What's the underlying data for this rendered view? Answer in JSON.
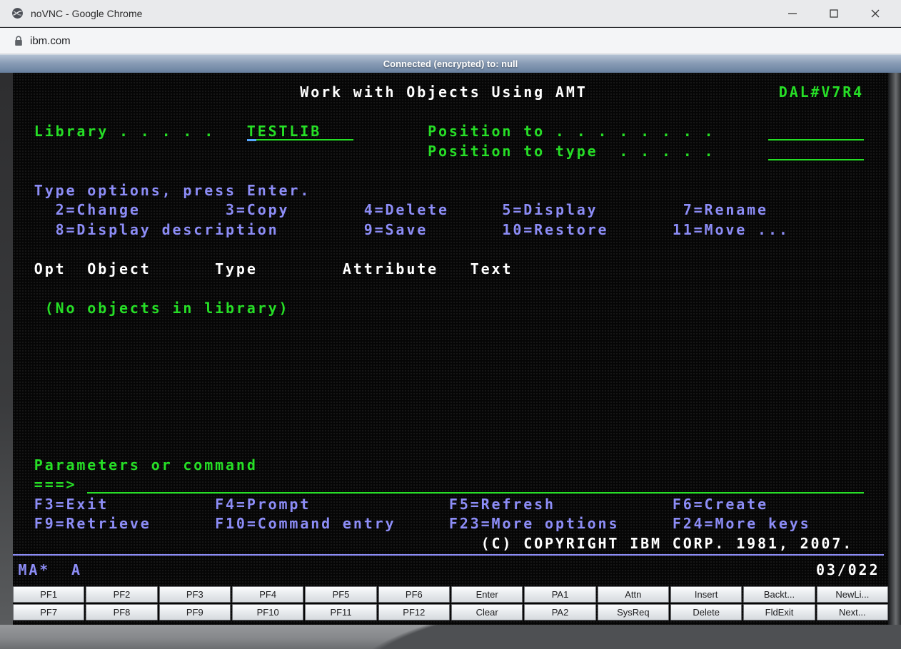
{
  "browser": {
    "title": "noVNC - Google Chrome",
    "url": "ibm.com"
  },
  "vnc": {
    "status": "Connected (encrypted) to: null"
  },
  "terminal": {
    "palette": {
      "green": "#26df26",
      "blue": "#8d8df7",
      "white": "#ffffff",
      "cursor_blue": "#57a8ff",
      "background": "#060606"
    },
    "cursor": {
      "row": 3,
      "col": 22
    },
    "segments": [
      {
        "name": "screen-title",
        "row": 1,
        "col": 27,
        "color": "white",
        "text": "Work with Objects Using AMT"
      },
      {
        "name": "system-name",
        "row": 1,
        "col": 72,
        "color": "green",
        "text": "DAL#V7R4"
      },
      {
        "name": "library-label",
        "row": 3,
        "col": 2,
        "color": "green",
        "text": "Library . . . . ."
      },
      {
        "name": "library-field",
        "row": 3,
        "col": 22,
        "color": "green",
        "text": "TESTLIB",
        "field": 10
      },
      {
        "name": "position-to-label",
        "row": 3,
        "col": 39,
        "color": "green",
        "text": "Position to . . . . . . . ."
      },
      {
        "name": "position-to-field",
        "row": 3,
        "col": 71,
        "color": "green",
        "text": "",
        "field": 9
      },
      {
        "name": "position-to-type-label",
        "row": 4,
        "col": 39,
        "color": "green",
        "text": "Position to type  . . . . ."
      },
      {
        "name": "position-to-type-field",
        "row": 4,
        "col": 71,
        "color": "green",
        "text": "",
        "field": 9
      },
      {
        "name": "options-instruction",
        "row": 6,
        "col": 2,
        "color": "blue",
        "text": "Type options, press Enter."
      },
      {
        "name": "options-row-1",
        "row": 7,
        "col": 4,
        "color": "blue",
        "text": "2=Change        3=Copy       4=Delete     5=Display        7=Rename"
      },
      {
        "name": "options-row-2",
        "row": 8,
        "col": 4,
        "color": "blue",
        "text": "8=Display description        9=Save       10=Restore      11=Move ..."
      },
      {
        "name": "column-headers",
        "row": 10,
        "col": 2,
        "color": "white",
        "text": "Opt  Object      Type        Attribute   Text"
      },
      {
        "name": "empty-list-message",
        "row": 12,
        "col": 3,
        "color": "green",
        "text": "(No objects in library)"
      },
      {
        "name": "parameters-label",
        "row": 20,
        "col": 2,
        "color": "green",
        "text": "Parameters or command"
      },
      {
        "name": "command-prompt",
        "row": 21,
        "col": 2,
        "color": "green",
        "text": "===>"
      },
      {
        "name": "command-input-field",
        "row": 21,
        "col": 7,
        "color": "green",
        "text": "",
        "field": 73
      },
      {
        "name": "fkeys-row-1",
        "row": 22,
        "col": 2,
        "color": "blue",
        "text": "F3=Exit          F4=Prompt             F5=Refresh           F6=Create"
      },
      {
        "name": "fkeys-row-2",
        "row": 23,
        "col": 2,
        "color": "blue",
        "text": "F9=Retrieve      F10=Command entry     F23=More options     F24=More keys"
      },
      {
        "name": "copyright-line",
        "row": 24,
        "col": 44,
        "color": "white",
        "text": "(C) COPYRIGHT IBM CORP. 1981, 2007."
      },
      {
        "name": "oia-status",
        "row": 25.35,
        "col": 0.5,
        "color": "blue",
        "text": "MA*"
      },
      {
        "name": "oia-shift-indicator",
        "row": 25.35,
        "col": 5.5,
        "color": "blue",
        "text": "A"
      },
      {
        "name": "oia-cursor-position",
        "row": 25.35,
        "col": 75.5,
        "color": "white",
        "text": "03/022"
      }
    ]
  },
  "keypad": {
    "rows": [
      [
        "PF1",
        "PF2",
        "PF3",
        "PF4",
        "PF5",
        "PF6",
        "Enter",
        "PA1",
        "Attn",
        "Insert",
        "Backt...",
        "NewLi..."
      ],
      [
        "PF7",
        "PF8",
        "PF9",
        "PF10",
        "PF11",
        "PF12",
        "Clear",
        "PA2",
        "SysReq",
        "Delete",
        "FldExit",
        "Next..."
      ]
    ]
  }
}
